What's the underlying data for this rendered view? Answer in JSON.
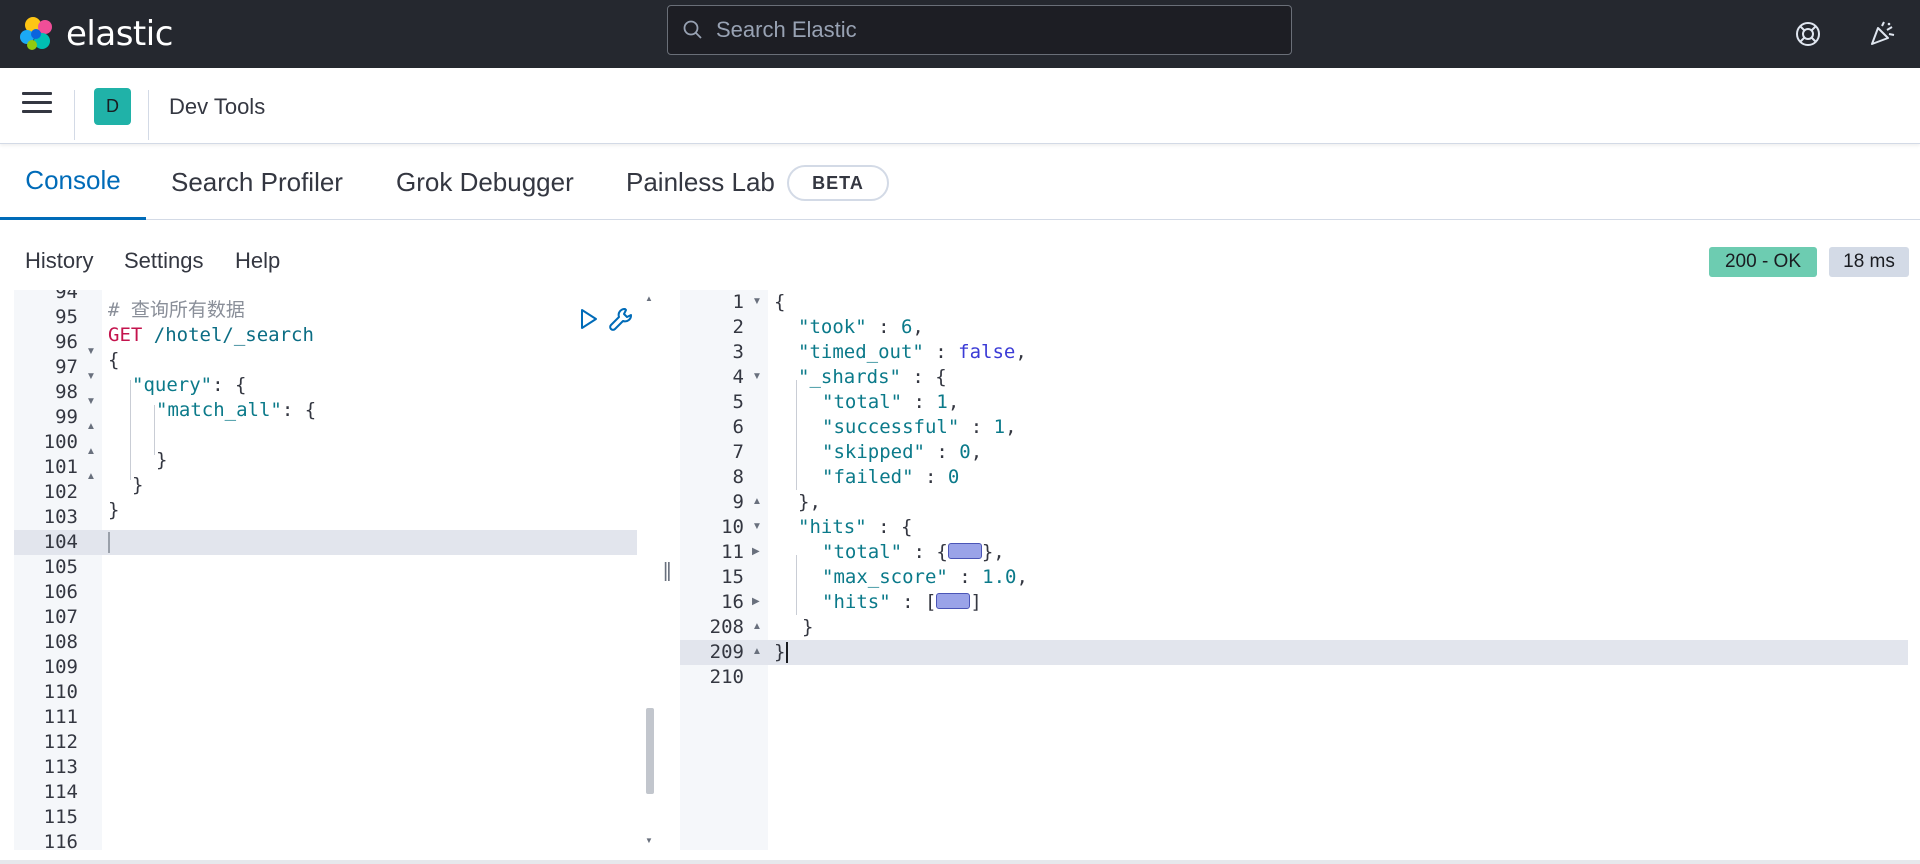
{
  "header": {
    "brand": "elastic",
    "search_placeholder": "Search Elastic",
    "help_icon": "help-lifebuoy-icon",
    "news_icon": "news-cheer-icon"
  },
  "breadcrumb": {
    "space_initial": "D",
    "title": "Dev Tools"
  },
  "tabs": [
    {
      "label": "Console",
      "active": true
    },
    {
      "label": "Search Profiler",
      "active": false
    },
    {
      "label": "Grok Debugger",
      "active": false
    },
    {
      "label": "Painless Lab",
      "active": false,
      "badge": "BETA"
    }
  ],
  "console_toolbar": {
    "history": "History",
    "settings": "Settings",
    "help": "Help",
    "status": "200 - OK",
    "duration": "18 ms"
  },
  "request_editor": {
    "line_numbers": [
      "94",
      "95",
      "96",
      "97",
      "98",
      "99",
      "100",
      "101",
      "102",
      "103",
      "104",
      "105",
      "106",
      "107",
      "108",
      "109",
      "110",
      "111",
      "112",
      "113",
      "114",
      "115",
      "116"
    ],
    "comment": "# 查询所有数据",
    "method": "GET",
    "url": " /hotel/_search",
    "open_brace": "{",
    "query_key": "\"query\"",
    "colon_brace": ": {",
    "match_all_key": "\"match_all\"",
    "close_brace": "}",
    "active_line": "104"
  },
  "response_editor": {
    "line_numbers": [
      "1",
      "2",
      "3",
      "4",
      "5",
      "6",
      "7",
      "8",
      "9",
      "10",
      "11",
      "15",
      "16",
      "208",
      "209",
      "210"
    ],
    "took_key": "\"took\"",
    "took_val": "6",
    "timed_out_key": "\"timed_out\"",
    "timed_out_val": "false",
    "shards_key": "\"_shards\"",
    "total_key": "\"total\"",
    "total_val": "1",
    "successful_key": "\"successful\"",
    "successful_val": "1",
    "skipped_key": "\"skipped\"",
    "skipped_val": "0",
    "failed_key": "\"failed\"",
    "failed_val": "0",
    "hits_key": "\"hits\"",
    "max_score_key": "\"max_score\"",
    "max_score_val": "1.0",
    "active_line": "209"
  },
  "colors": {
    "header_bg": "#25282f",
    "accent": "#006bb8",
    "status_ok": "#6dccb1",
    "space_avatar": "#20b2a8"
  }
}
